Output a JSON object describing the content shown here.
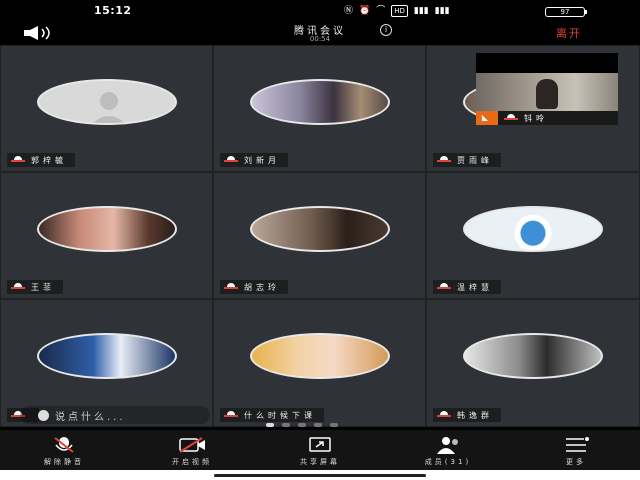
{
  "status_bar": {
    "time": "15:12",
    "icons": [
      "nfc-icon",
      "alarm-icon",
      "wifi-icon",
      "hd-icon",
      "signal-icon",
      "signal-icon"
    ],
    "hd_label": "HD",
    "battery": "97"
  },
  "header": {
    "title": "腾讯会议",
    "timer": "00:54",
    "leave_label": "离开"
  },
  "participants": [
    {
      "name": "郭梓毓"
    },
    {
      "name": "刘新月"
    },
    {
      "name": "贾雨峰"
    },
    {
      "name": "王菲"
    },
    {
      "name": "胡志玲"
    },
    {
      "name": "温梓慧"
    },
    {
      "name": ""
    },
    {
      "name": "什么时候下课"
    },
    {
      "name": "韩逸群"
    }
  ],
  "video_inset": {
    "name": "钭呤"
  },
  "chat_overlay": {
    "text": "说点什么..."
  },
  "page_dots": {
    "count": 5,
    "active": 1
  },
  "toolbar": [
    {
      "label": "解除静音",
      "icon": "mic-muted-icon"
    },
    {
      "label": "开启视频",
      "icon": "camera-off-icon"
    },
    {
      "label": "共享屏幕",
      "icon": "share-screen-icon"
    },
    {
      "label": "成员(31)",
      "icon": "members-icon"
    },
    {
      "label": "更多",
      "icon": "more-icon"
    }
  ],
  "colors": {
    "accent_red": "#e0413a",
    "tile_bg": "#2f3337",
    "camera_orange": "#e86a16"
  }
}
